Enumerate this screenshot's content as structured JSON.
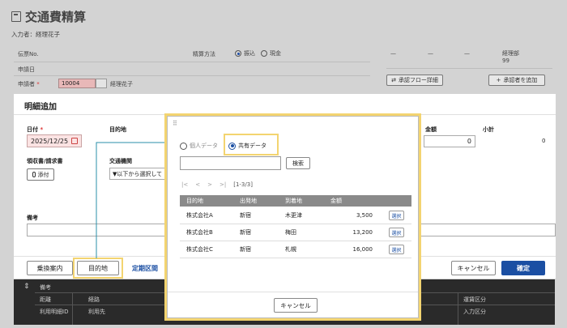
{
  "page": {
    "title": "交通費精算",
    "entrant_label": "入力者：",
    "entrant_name": "経理花子",
    "fields": {
      "voucher_no": "伝票No.",
      "apply_date": "申請日",
      "applicant": "申請者",
      "applicant_required": "*",
      "applicant_code": "10004",
      "applicant_name": "経理花子",
      "settle_method": "精算方法",
      "settle_transfer": "振込",
      "settle_cash": "現金"
    },
    "approval": {
      "cols": [
        "—",
        "—",
        "—"
      ],
      "dept": "経理部",
      "dept_num": "99",
      "flow_button": "承認フロー詳細",
      "add_button": "承認者を追加"
    },
    "bottom_grid": {
      "row1": "備考",
      "row2": [
        "距離",
        "経路",
        "運賃区分"
      ],
      "row3": [
        "利用明細ID",
        "利用先",
        "入力区分"
      ]
    }
  },
  "modal": {
    "title": "明細追加",
    "date_label": "日付",
    "date_required": "*",
    "date_value": "2025/12/25",
    "destination_label": "目的地",
    "receipt_label": "領収書/請求書",
    "attach_button": "添付",
    "transport_label": "交通機関",
    "transport_placeholder": "▼以下から選択して",
    "remarks_label": "備考",
    "amount_label": "金額",
    "amount_value": "0",
    "subtotal_label": "小計",
    "subtotal_value": "0",
    "footer": {
      "transfer_guide": "乗換案内",
      "destination": "目的地",
      "fixed_section": "定期区間",
      "cancel": "キャンセル",
      "confirm": "確定"
    }
  },
  "popup": {
    "grip": "⠿",
    "radio_personal": "個人データ",
    "radio_shared": "共有データ",
    "search_button": "検索",
    "pager": {
      "first": "|<",
      "prev": "<",
      "next": ">",
      "last": ">|",
      "range": "[1-3/3]"
    },
    "columns": [
      "目的地",
      "出発地",
      "到着地",
      "金額"
    ],
    "rows": [
      {
        "destination": "株式会社A",
        "from": "新宿",
        "to": "木更津",
        "amount": "3,500",
        "select": "選択"
      },
      {
        "destination": "株式会社B",
        "from": "新宿",
        "to": "梅田",
        "amount": "13,200",
        "select": "選択"
      },
      {
        "destination": "株式会社C",
        "from": "新宿",
        "to": "札幌",
        "amount": "16,000",
        "select": "選択"
      }
    ],
    "cancel_button": "キャンセル"
  },
  "colors": {
    "accent": "#1b4fa3",
    "highlight": "#f3d470",
    "connector": "#2a8fa8"
  }
}
